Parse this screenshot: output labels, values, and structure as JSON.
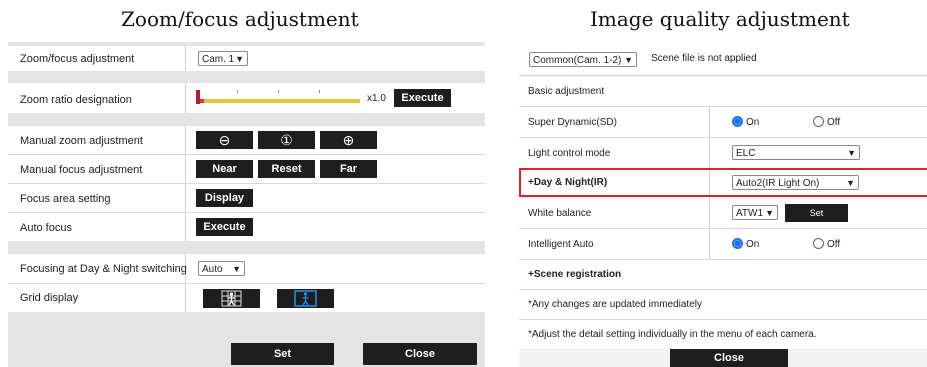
{
  "left": {
    "caption": "Zoom/focus adjustment",
    "rows": {
      "zoom_focus": {
        "label": "Zoom/focus adjustment",
        "value": "Cam. 1"
      },
      "zoom_ratio": {
        "label": "Zoom ratio designation",
        "value": "x1.0",
        "button": "Execute",
        "level": 0.05
      },
      "manual_zoom": {
        "label": "Manual zoom adjustment"
      },
      "manual_focus": {
        "label": "Manual focus adjustment",
        "near": "Near",
        "reset": "Reset",
        "far": "Far"
      },
      "focus_area": {
        "label": "Focus area setting",
        "button": "Display"
      },
      "auto_focus": {
        "label": "Auto focus",
        "button": "Execute"
      },
      "day_night": {
        "label": "Focusing at Day & Night switching",
        "value": "Auto"
      },
      "grid": {
        "label": "Grid display"
      }
    },
    "set": "Set",
    "close": "Close"
  },
  "right": {
    "caption": "Image quality adjustment",
    "camera_select": "Common(Cam. 1-2)",
    "scene_status": "Scene file is not applied",
    "basic": "Basic adjustment",
    "super_dynamic": {
      "label": "Super Dynamic(SD)",
      "on": "On",
      "off": "Off",
      "selected": "On"
    },
    "light_control": {
      "label": "Light control mode",
      "value": "ELC"
    },
    "day_night": {
      "label": "+Day & Night(IR)",
      "value": "Auto2(IR Light On)"
    },
    "white_balance": {
      "label": "White balance",
      "value": "ATW1",
      "button": "Set"
    },
    "intelligent_auto": {
      "label": "Intelligent Auto",
      "on": "On",
      "off": "Off",
      "selected": "On"
    },
    "scene_registration": "+Scene registration",
    "note1": "*Any changes are updated immediately",
    "note2": "*Adjust the detail setting individually in the menu of each camera.",
    "close": "Close"
  },
  "colors": {
    "highlight": "#e0212b",
    "button": "#1e1e1e",
    "radio": "#1a73e8",
    "zoom_bar": "#e3c63a",
    "zoom_fill": "#d03a3a"
  }
}
